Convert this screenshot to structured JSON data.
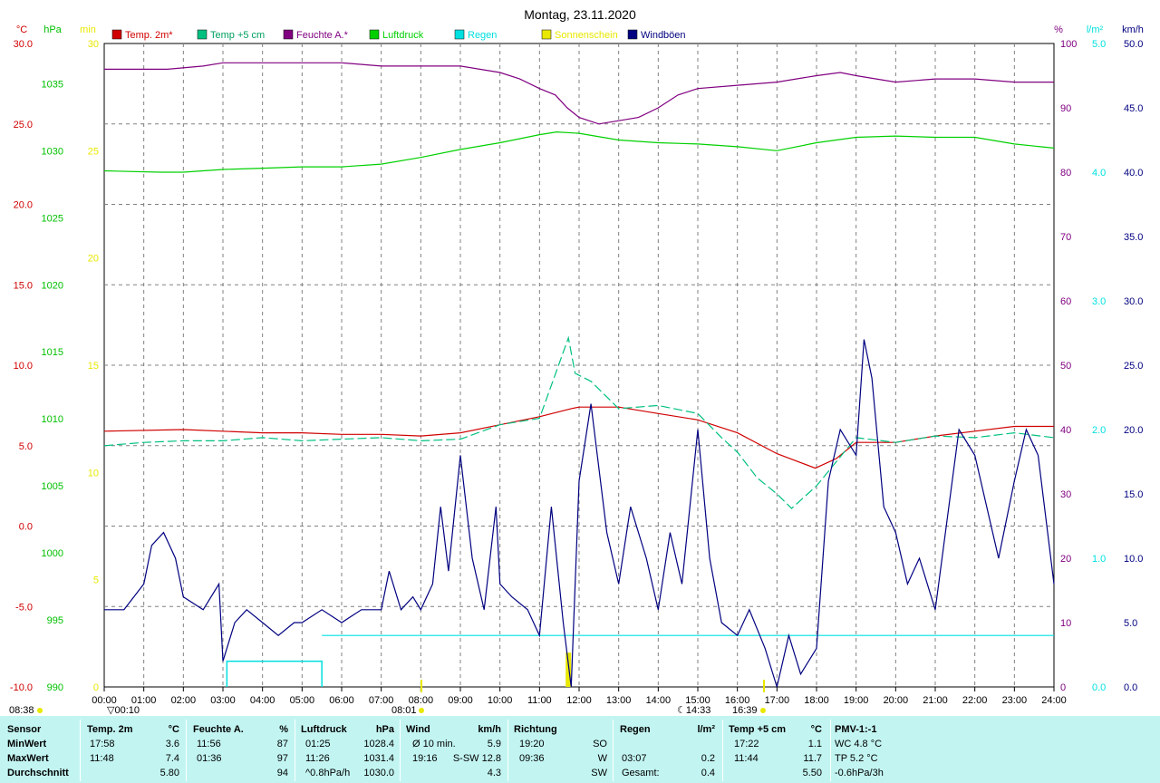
{
  "chart_data": {
    "type": "line",
    "title": "Montag, 23.11.2020",
    "x_ticks": [
      "00:00",
      "01:00",
      "02:00",
      "03:00",
      "04:00",
      "05:00",
      "06:00",
      "07:00",
      "08:00",
      "09:00",
      "10:00",
      "11:00",
      "12:00",
      "13:00",
      "14:00",
      "15:00",
      "16:00",
      "17:00",
      "18:00",
      "19:00",
      "20:00",
      "21:00",
      "22:00",
      "23:00",
      "24:00"
    ],
    "x_range_hours": [
      0,
      24
    ],
    "axes": {
      "temp_c": {
        "unit": "°C",
        "color": "#d00000",
        "range": [
          -10,
          30
        ],
        "ticks": [
          "30.0",
          "25.0",
          "20.0",
          "15.0",
          "10.0",
          "5.0",
          "0.0",
          "-5.0",
          "-10.0"
        ]
      },
      "pressure_hpa": {
        "unit": "hPa",
        "color": "#00c000",
        "range": [
          990,
          1038
        ],
        "ticks": [
          "1035",
          "1030",
          "1025",
          "1020",
          "1015",
          "1010",
          "1005",
          "1000",
          "995",
          "990"
        ]
      },
      "sun_min": {
        "unit": "min",
        "color": "#e8e800",
        "range": [
          0,
          30
        ],
        "ticks": [
          "30",
          "25",
          "20",
          "15",
          "10",
          "5",
          "0"
        ]
      },
      "humidity_pct": {
        "unit": "%",
        "color": "#800080",
        "range": [
          0,
          100
        ],
        "ticks": [
          "100",
          "90",
          "80",
          "70",
          "60",
          "50",
          "40",
          "30",
          "20",
          "10",
          "0"
        ]
      },
      "rain_lm2": {
        "unit": "l/m²",
        "color": "#00e0e0",
        "range": [
          0,
          5
        ],
        "ticks": [
          "5.0",
          "4.0",
          "3.0",
          "2.0",
          "1.0",
          "0.0"
        ]
      },
      "wind_kmh": {
        "unit": "km/h",
        "color": "#000080",
        "range": [
          0,
          50
        ],
        "ticks": [
          "50.0",
          "45.0",
          "40.0",
          "35.0",
          "30.0",
          "25.0",
          "20.0",
          "15.0",
          "10.0",
          "5.0",
          "0.0"
        ]
      }
    },
    "legend": [
      {
        "name": "Temp. 2m*",
        "color": "#d00000"
      },
      {
        "name": "Temp +5 cm",
        "color": "#00c080"
      },
      {
        "name": "Feuchte A.*",
        "color": "#800080"
      },
      {
        "name": "Luftdruck",
        "color": "#00d000"
      },
      {
        "name": "Regen",
        "color": "#00e0e0"
      },
      {
        "name": "Sonnenschein",
        "color": "#e8e800"
      },
      {
        "name": "Windböen",
        "color": "#000080"
      }
    ],
    "series": [
      {
        "name": "Temp. 2m*",
        "axis": "temp_c",
        "color": "#d00000",
        "x": [
          0,
          2,
          3,
          4,
          5,
          6,
          7,
          8,
          9,
          10,
          11,
          11.8,
          12,
          13,
          14,
          15,
          16,
          17,
          17.97,
          18.5,
          19,
          20,
          21,
          22,
          23,
          24
        ],
        "y": [
          5.9,
          6.0,
          5.9,
          5.8,
          5.8,
          5.7,
          5.7,
          5.6,
          5.8,
          6.3,
          6.8,
          7.3,
          7.4,
          7.4,
          7.0,
          6.6,
          5.8,
          4.5,
          3.6,
          4.2,
          5.2,
          5.2,
          5.6,
          5.9,
          6.2,
          6.2
        ]
      },
      {
        "name": "Temp +5 cm",
        "axis": "temp_c",
        "color": "#00c080",
        "x": [
          0,
          1,
          2,
          3,
          4,
          5,
          6,
          7,
          8,
          9,
          10,
          11,
          11.73,
          11.9,
          12.3,
          13,
          14,
          15,
          15.6,
          16,
          16.5,
          17,
          17.37,
          18,
          18.5,
          19,
          20,
          21,
          22,
          23,
          24
        ],
        "y": [
          5.0,
          5.2,
          5.3,
          5.3,
          5.5,
          5.3,
          5.4,
          5.5,
          5.3,
          5.4,
          6.3,
          6.7,
          11.7,
          9.5,
          9.0,
          7.3,
          7.5,
          7.0,
          5.5,
          4.6,
          3.0,
          2.0,
          1.1,
          2.5,
          4.0,
          5.5,
          5.2,
          5.6,
          5.5,
          5.8,
          5.5
        ]
      },
      {
        "name": "Feuchte A.*",
        "axis": "humidity_pct",
        "color": "#800080",
        "x": [
          0,
          1.6,
          2.5,
          3,
          4,
          5,
          6,
          7,
          8,
          9,
          10,
          10.5,
          11,
          11.4,
          11.7,
          12,
          12.5,
          13,
          13.5,
          14,
          14.5,
          15,
          16,
          17,
          18,
          18.6,
          19,
          20,
          21,
          22,
          23,
          24
        ],
        "y": [
          96,
          96,
          96.5,
          97,
          97,
          97,
          97,
          96.5,
          96.5,
          96.5,
          95.5,
          94.5,
          93,
          92,
          90,
          88.5,
          87.5,
          88,
          88.5,
          90,
          92,
          93,
          93.5,
          94,
          95,
          95.5,
          95,
          94,
          94.5,
          94.5,
          94,
          94
        ]
      },
      {
        "name": "Luftdruck",
        "axis": "pressure_hpa",
        "color": "#00d000",
        "x": [
          0,
          1.42,
          2,
          3,
          4,
          5,
          6,
          7,
          8,
          9,
          10,
          11,
          11.43,
          12,
          13,
          14,
          15,
          16,
          17,
          18,
          19,
          20,
          21,
          22,
          23,
          24
        ],
        "y": [
          1028.5,
          1028.4,
          1028.4,
          1028.6,
          1028.7,
          1028.8,
          1028.8,
          1029.0,
          1029.5,
          1030.1,
          1030.6,
          1031.2,
          1031.4,
          1031.3,
          1030.8,
          1030.6,
          1030.5,
          1030.3,
          1030.0,
          1030.6,
          1031.0,
          1031.1,
          1031.0,
          1031.0,
          1030.5,
          1030.2
        ]
      },
      {
        "name": "Windböen",
        "axis": "wind_kmh",
        "color": "#000080",
        "x": [
          0,
          0.5,
          1,
          1.2,
          1.5,
          1.8,
          2,
          2.5,
          2.9,
          3,
          3.3,
          3.6,
          4,
          4.4,
          4.8,
          5,
          5.5,
          6,
          6.5,
          7,
          7.2,
          7.5,
          7.8,
          8,
          8.3,
          8.5,
          8.7,
          9,
          9.3,
          9.6,
          9.9,
          10,
          10.3,
          10.7,
          11,
          11.3,
          11.6,
          11.8,
          12,
          12.3,
          12.7,
          13,
          13.3,
          13.7,
          14,
          14.3,
          14.6,
          15,
          15.3,
          15.6,
          16,
          16.3,
          16.7,
          17,
          17.3,
          17.6,
          18,
          18.3,
          18.6,
          19,
          19.2,
          19.4,
          19.7,
          20,
          20.3,
          20.6,
          21,
          21.3,
          21.6,
          22,
          22.3,
          22.6,
          23,
          23.3,
          23.6,
          24
        ],
        "y": [
          6,
          6,
          8,
          11,
          12,
          10,
          7,
          6,
          8,
          2,
          5,
          6,
          5,
          4,
          5,
          5,
          6,
          5,
          6,
          6,
          9,
          6,
          7,
          6,
          8,
          14,
          9,
          18,
          10,
          6,
          14,
          8,
          7,
          6,
          4,
          14,
          5,
          0,
          16,
          22,
          12,
          8,
          14,
          10,
          6,
          12,
          8,
          20,
          10,
          5,
          4,
          6,
          3,
          0,
          4,
          1,
          3,
          16,
          20,
          18,
          27,
          24,
          14,
          12,
          8,
          10,
          6,
          13,
          20,
          18,
          14,
          10,
          16,
          20,
          18,
          8
        ]
      }
    ],
    "rain_bars": {
      "x_range": [
        3.1,
        5.5
      ],
      "value": 0.2
    },
    "rain_total_line": {
      "value": 0.4
    },
    "sunshine_bars": [
      {
        "x": 11.73,
        "minutes": 1.6
      }
    ],
    "markers": {
      "left_sunrise": "08:38",
      "sunrise": "08:01",
      "moon": "14:33",
      "sunset": "16:39",
      "min_temp_mark": "00:10"
    }
  },
  "stats": {
    "headers": {
      "sensor": "Sensor",
      "temp": "Temp. 2m",
      "temp_u": "°C",
      "hum": "Feuchte A.",
      "hum_u": "%",
      "press": "Luftdruck",
      "press_u": "hPa",
      "wind": "Wind",
      "wind_u": "km/h",
      "dir": "Richtung",
      "rain": "Regen",
      "rain_u": "l/m²",
      "t5": "Temp +5 cm",
      "t5_u": "°C",
      "pmv": "PMV-1:-1"
    },
    "rows": [
      {
        "label": "MinWert",
        "temp_t": "17:58",
        "temp_v": "3.6",
        "hum_t": "11:56",
        "hum_v": "87",
        "press_t": "01:25",
        "press_v": "1028.4",
        "wind_t": "Ø 10 min.",
        "wind_v": "5.9",
        "dir_t": "19:20",
        "dir_v": "SO",
        "rain_t": "",
        "rain_v": "",
        "t5_t": "17:22",
        "t5_v": "1.1",
        "pmv": "WC 4.8 °C"
      },
      {
        "label": "MaxWert",
        "temp_t": "11:48",
        "temp_v": "7.4",
        "hum_t": "01:36",
        "hum_v": "97",
        "press_t": "11:26",
        "press_v": "1031.4",
        "wind_t": "19:16",
        "wind_v": "S-SW 12.8",
        "dir_t": "09:36",
        "dir_v": "W",
        "rain_t": "03:07",
        "rain_v": "0.2",
        "t5_t": "11:44",
        "t5_v": "11.7",
        "pmv": "TP 5.2 °C"
      },
      {
        "label": "Durchschnitt",
        "temp_t": "",
        "temp_v": "5.80",
        "hum_t": "",
        "hum_v": "94",
        "press_t": "^0.8hPa/h",
        "press_v": "1030.0",
        "wind_t": "",
        "wind_v": "4.3",
        "dir_t": "",
        "dir_v": "SW",
        "rain_t": "Gesamt:",
        "rain_v": "0.4",
        "t5_t": "",
        "t5_v": "5.50",
        "pmv": "-0.6hPa/3h"
      }
    ]
  }
}
